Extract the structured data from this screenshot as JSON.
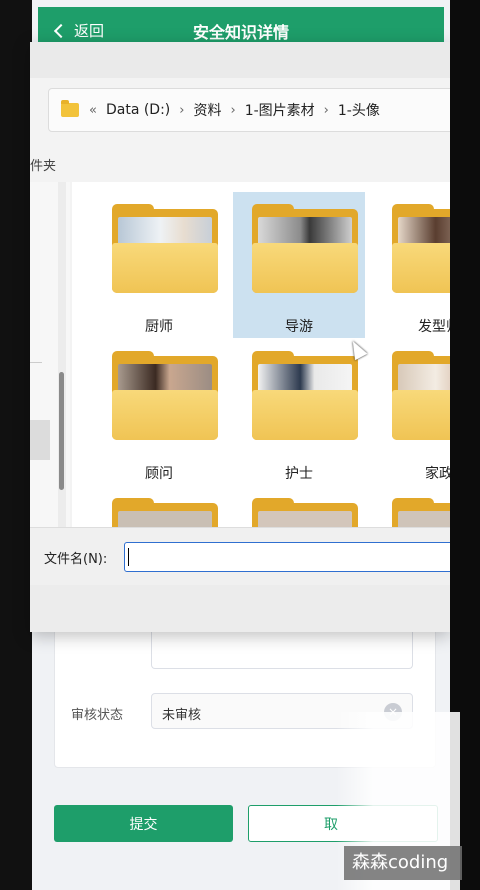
{
  "header": {
    "back_label": "返回",
    "title": "安全知识详情"
  },
  "form": {
    "status_label": "审核状态",
    "status_value": "未审核",
    "submit_label": "提交",
    "cancel_label": "取"
  },
  "dialog": {
    "breadcrumb": [
      "Data (D:)",
      "资料",
      "1-图片素材",
      "1-头像"
    ],
    "left_label": "件夹",
    "folders": [
      {
        "label": "厨师",
        "selected": false
      },
      {
        "label": "导游",
        "selected": true
      },
      {
        "label": "发型师",
        "selected": false
      },
      {
        "label": "顾问",
        "selected": false
      },
      {
        "label": "护士",
        "selected": false
      },
      {
        "label": "家政",
        "selected": false
      }
    ],
    "filename_label": "文件名(N):",
    "filename_value": ""
  },
  "watermark": "森森coding"
}
